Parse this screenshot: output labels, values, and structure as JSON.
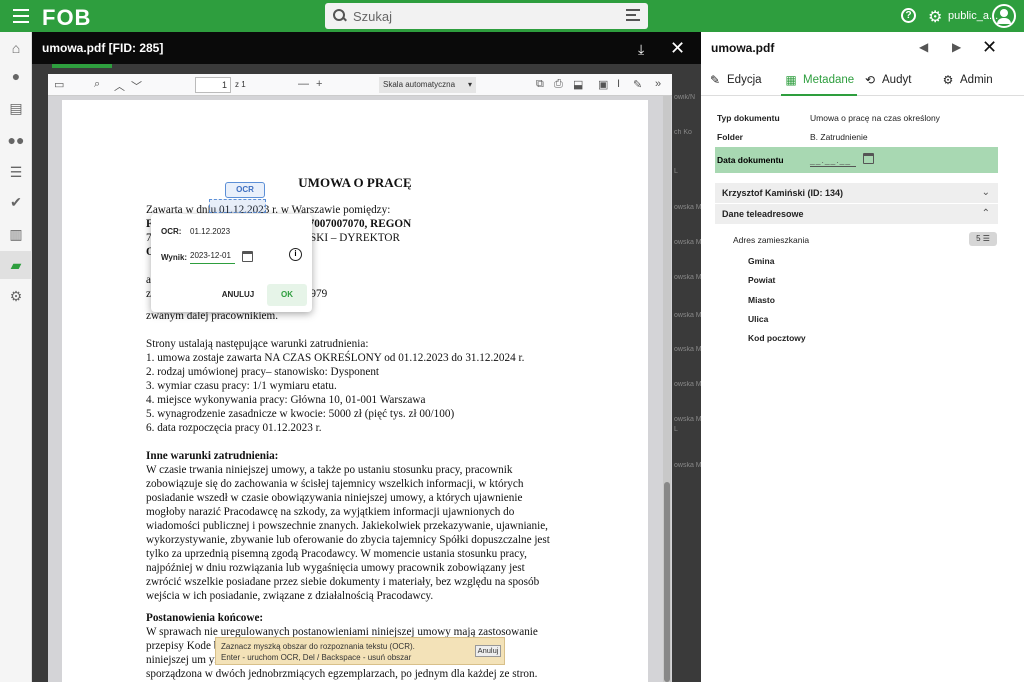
{
  "app": {
    "logo": "FOB",
    "search_placeholder": "Szukaj",
    "user": "public_a..."
  },
  "viewer": {
    "title": "umowa.pdf [FID: 285]",
    "page_current": "1",
    "page_total": "z 1",
    "scale": "Skala automatyczna"
  },
  "doc": {
    "title": "UMOWA O PRACĘ",
    "lines": [
      "Zawarta w dniu 01.12.2023 r. w Warszawie pomiędzy:",
      "FIR                        a 10, 01-001 Warszawa, NIP: 7007007070, REGON",
      "700                        zentowaną przez: JAN KOWALSKI – DYREKTOR",
      "OPI                         dawcą,",
      "a Pa",
      "zam                        giełły 5b/38, PESEL: 71021833979",
      "zwanym dalej pracownikiem.",
      "Strony ustalają następujące warunki zatrudnienia:",
      "1.   umowa zostaje zawarta NA CZAS OKREŚLONY od  01.12.2023 do 31.12.2024 r.",
      "2.   rodzaj umówionej pracy– stanowisko: Dysponent",
      "3.   wymiar czasu pracy:  1/1 wymiaru etatu.",
      "4.   miejsce wykonywania pracy: Główna 10, 01-001 Warszawa",
      "5.   wynagrodzenie zasadnicze w kwocie: 5000 zł (pięć tys. zł  00/100)",
      "6.   data rozpoczęcia pracy 01.12.2023 r.",
      "Inne warunki zatrudnienia:",
      "W czasie trwania niniejszej umowy, a także po ustaniu stosunku pracy, pracownik",
      "zobowiązuje się do zachowania w ścisłej tajemnicy wszelkich informacji, w których",
      "posiadanie wszedł w czasie obowiązywania niniejszej umowy, a których ujawnienie",
      "mogłoby narazić Pracodawcę na szkody, za wyjątkiem informacji ujawnionych do",
      "wiadomości publicznej i powszechnie znanych. Jakiekolwiek przekazywanie, ujawnianie,",
      "wykorzystywanie, zbywanie lub oferowanie do zbycia tajemnicy Spółki dopuszczalne jest",
      "tylko za uprzednią pisemną zgodą Pracodawcy. W momencie ustania stosunku pracy,",
      "najpóźniej w dniu rozwiązania lub wygaśnięcia umowy pracownik zobowiązany jest",
      "zwrócić wszelkie posiadane przez siebie dokumenty i materiały, bez względu na sposób",
      "wejścia w ich posiadanie, związane z działalnością Pracodawcy.",
      "Postanowienia końcowe:",
      "W sprawach nie uregulowanych postanowieniami niniejszej umowy mają zastosowanie",
      "przepisy Kode                                                                                  b uzupełnienia",
      "niniejszej  um                                                                                 ymowa została",
      "sporządzona w dwóch jednobrzmiących egzemplarzach, po jednym dla każdej ze stron."
    ]
  },
  "ocr": {
    "badge": "OCR",
    "ocr_label": "OCR:",
    "ocr_value": "01.12.2023",
    "result_label": "Wynik:",
    "result_value": "2023-12-01",
    "cancel": "ANULUJ",
    "ok": "OK",
    "info": "i"
  },
  "toast": {
    "line1": "Zaznacz myszką obszar do rozpoznania tekstu (OCR).",
    "line2": "Enter - uruchom OCR, Del / Backspace - usuń obszar",
    "button": "Anuluj"
  },
  "bg_strip": [
    "owik/N",
    "ch Ko",
    "L",
    "owska M",
    "owska M",
    "owska M",
    "owska M",
    "owska M",
    "owska M",
    "owska M",
    "L",
    "owska M"
  ],
  "panel": {
    "title": "umowa.pdf",
    "tabs": [
      {
        "label": "Edycja",
        "icon": "pencil-icon"
      },
      {
        "label": "Metadane",
        "icon": "table-icon"
      },
      {
        "label": "Audyt",
        "icon": "history-icon"
      },
      {
        "label": "Admin",
        "icon": "gear-icon"
      }
    ],
    "meta": [
      {
        "label": "Typ dokumentu",
        "value": "Umowa o pracę na czas określony"
      },
      {
        "label": "Folder",
        "value": "B. Zatrudnienie"
      }
    ],
    "date_label": "Data dokumentu",
    "date_mask": "__.__.__",
    "section1": "Krzysztof Kamiński (ID: 134)",
    "section2": "Dane teleadresowe",
    "address_label": "Adres zamieszkania",
    "address_count": "5",
    "address_fields": [
      "Gmina",
      "Powiat",
      "Miasto",
      "Ulica",
      "Kod pocztowy"
    ]
  },
  "colors": {
    "accent": "#2e9e3e",
    "highlight": "#a8d8b2"
  }
}
